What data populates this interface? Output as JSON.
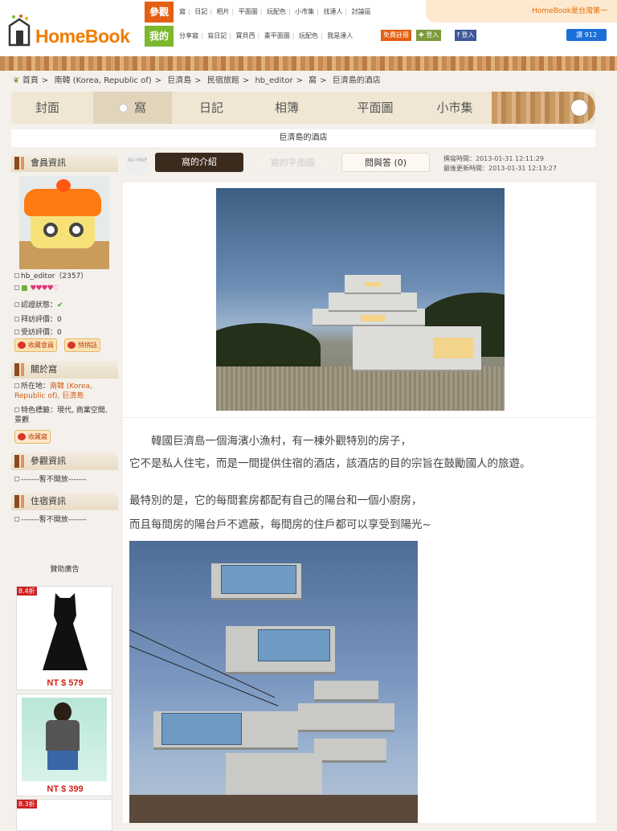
{
  "header": {
    "logo_text": "HomeBook",
    "row1_tag": "參觀",
    "row1_links": [
      "窩",
      "日記",
      "相片",
      "平面圖",
      "玩配色",
      "小市集",
      "找達人",
      "討論區"
    ],
    "row2_tag": "我的",
    "row2_links": [
      "分享窩",
      "寫日記",
      "寶貝西",
      "畫平面圖",
      "玩配色",
      "我是達人"
    ],
    "register": "免費註冊",
    "login": "登入",
    "fb_login": "登入",
    "announcement": "HomeBook是台灣第一",
    "like_count": "讚 912",
    "colors": {
      "orange": "#e35f12",
      "green": "#7cb82f",
      "brand": "#f07c00"
    }
  },
  "breadcrumb": [
    "首頁",
    "南韓 (Korea, Republic of)",
    "巨濟島",
    "民宿旅館",
    "hb_editor",
    "窩",
    "巨濟島的酒店"
  ],
  "main_tabs": [
    "封面",
    "窩",
    "日記",
    "相簿",
    "平面圖",
    "小市集"
  ],
  "page_title": "巨濟島的酒店",
  "sidebar": {
    "member_title": "會員資訊",
    "username": "hb_editor（2357）",
    "hearts": "♥♥♥♥♡",
    "verify_label": "認證狀態：",
    "visit_label": "拜訪評價：0",
    "visited_label": "受訪評價：0",
    "fav_member_btn": "收藏會員",
    "msg_btn": "悄悄話",
    "about_title": "關於窩",
    "location_label": "所在地：",
    "location_value": "南韓 (Korea, Republic of), 巨濟島",
    "feature_label": "特色標籤：現代, 商業空間, 景觀",
    "fav_home_btn": "收藏窩",
    "visit_title": "參觀資訊",
    "visit_closed": "-------暫不開放-------",
    "stay_title": "住宿資訊",
    "stay_closed": "-------暫不開放-------",
    "ads_title": "贊助廣告",
    "ads": [
      {
        "discount": "8.4折",
        "price": "NT $ 579"
      },
      {
        "discount": "",
        "price": "NT $ 399"
      },
      {
        "discount": "8.3折",
        "price": ""
      }
    ]
  },
  "content_tabs": {
    "nomap": "NO MAP",
    "intro": "窩的介紹",
    "floorplan": "窩的平面圖",
    "qa": "問與答 (0)",
    "created": "撰寫時間：2013-01-31 12:11:29",
    "updated": "最後更新時間：2013-01-31 12:13:27"
  },
  "article": {
    "p1": "　　韓國巨濟島一個海濱小漁村，有一棟外觀特別的房子，",
    "p2": "它不是私人住宅，而是一間提供住宿的酒店，該酒店的目的宗旨在鼓勵國人的旅遊。",
    "p3": "最特別的是，它的每間套房都配有自己的陽台和一個小廚房，",
    "p4": "而且每間房的陽台戶不遮蔽，每間房的住戶都可以享受到陽光~"
  }
}
